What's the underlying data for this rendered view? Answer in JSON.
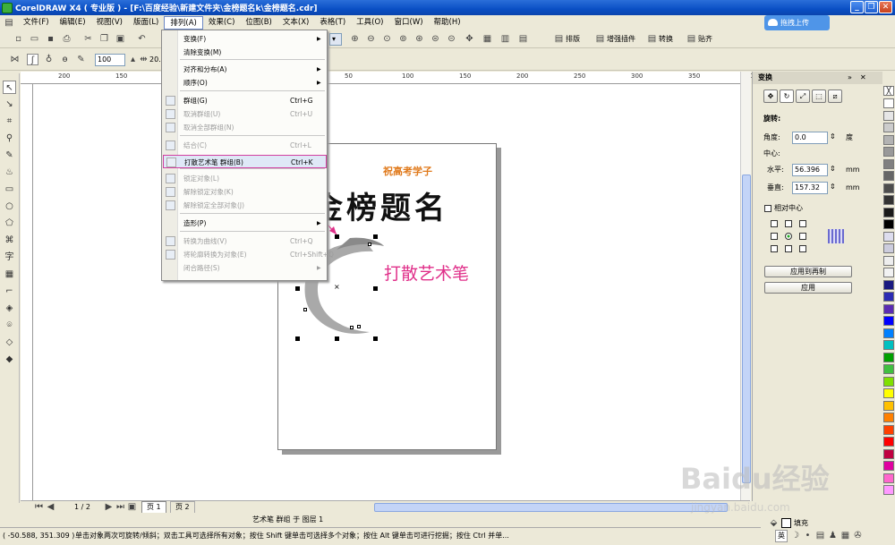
{
  "window": {
    "title": "CorelDRAW X4 ( 专业版 ) - [F:\\百度经验\\新建文件夹\\金榜题名k\\金榜题名.cdr]",
    "minimize": "_",
    "restore": "❐",
    "close": "✕"
  },
  "menubar": {
    "items": [
      "文件(F)",
      "编辑(E)",
      "视图(V)",
      "版面(L)",
      "排列(A)",
      "效果(C)",
      "位图(B)",
      "文本(X)",
      "表格(T)",
      "工具(O)",
      "窗口(W)",
      "帮助(H)"
    ],
    "active_index": 4
  },
  "upload_button": "拖拽上传",
  "toolbar": {
    "zoom_value": "100",
    "right_buttons": [
      "排版",
      "增强插件",
      "转换",
      "贴齐"
    ],
    "size_value": "20."
  },
  "dropdown": {
    "items": [
      {
        "label": "变换(F)",
        "shortcut": "",
        "submenu": true,
        "disabled": false
      },
      {
        "label": "清除变换(M)",
        "shortcut": "",
        "submenu": false,
        "disabled": false
      },
      {
        "label": "对齐和分布(A)",
        "shortcut": "",
        "submenu": true,
        "disabled": false
      },
      {
        "label": "顺序(O)",
        "shortcut": "",
        "submenu": true,
        "disabled": false
      },
      {
        "label": "群组(G)",
        "shortcut": "Ctrl+G",
        "submenu": false,
        "disabled": false
      },
      {
        "label": "取消群组(U)",
        "shortcut": "Ctrl+U",
        "submenu": false,
        "disabled": true
      },
      {
        "label": "取消全部群组(N)",
        "shortcut": "",
        "submenu": false,
        "disabled": true
      },
      {
        "label": "结合(C)",
        "shortcut": "Ctrl+L",
        "submenu": false,
        "disabled": true
      },
      {
        "label": "打散艺术笔 群组(B)",
        "shortcut": "Ctrl+K",
        "submenu": false,
        "disabled": false,
        "highlighted": true
      },
      {
        "label": "锁定对象(L)",
        "shortcut": "",
        "submenu": false,
        "disabled": true
      },
      {
        "label": "解除锁定对象(K)",
        "shortcut": "",
        "submenu": false,
        "disabled": true
      },
      {
        "label": "解除锁定全部对象(J)",
        "shortcut": "",
        "submenu": false,
        "disabled": true
      },
      {
        "label": "造形(P)",
        "shortcut": "",
        "submenu": true,
        "disabled": false
      },
      {
        "label": "转换为曲线(V)",
        "shortcut": "Ctrl+Q",
        "submenu": false,
        "disabled": true
      },
      {
        "label": "将轮廓转换为对象(E)",
        "shortcut": "Ctrl+Shift+Q",
        "submenu": false,
        "disabled": true
      },
      {
        "label": "闭合路径(S)",
        "shortcut": "",
        "submenu": true,
        "disabled": true
      }
    ]
  },
  "page": {
    "subtitle": "祝高考学子",
    "title": "金榜题名",
    "annotation": "打散艺术笔"
  },
  "ruler": {
    "h_ticks": [
      "200",
      "150",
      "100",
      "50",
      "0",
      "50",
      "100",
      "150",
      "200",
      "250",
      "300",
      "350",
      "400"
    ]
  },
  "docker": {
    "title": "变换",
    "rotate_label": "旋转:",
    "angle_label": "角度:",
    "angle_value": "0.0",
    "angle_unit": "度",
    "center_label": "中心:",
    "horizontal_label": "水平:",
    "horizontal_value": "56.396",
    "vertical_label": "垂直:",
    "vertical_value": "157.32",
    "unit": "mm",
    "relative_center": "相对中心",
    "apply_copy": "应用到再制",
    "apply": "应用"
  },
  "pagebar": {
    "page_counter": "1 / 2",
    "tabs": [
      "页 1",
      "页 2"
    ]
  },
  "infobar": {
    "object_info": "艺术笔 群组 于 图层 1"
  },
  "statusbar": {
    "coords": "( -50.588, 351.309 )",
    "hint": "单击对象两次可旋转/倾斜；双击工具可选择所有对象；按住 Shift 键单击可选择多个对象；按住 Alt 键单击可进行挖掘；按住 Ctrl 并单...",
    "fill_label": "填充",
    "ime": "英"
  },
  "watermark": {
    "text": "Baidu经验",
    "url": "jingyan.baidu.com"
  },
  "colors": {
    "accent": "#d23fa0",
    "title_orange": "#e07a1c",
    "annotation_pink": "#e0308a"
  }
}
